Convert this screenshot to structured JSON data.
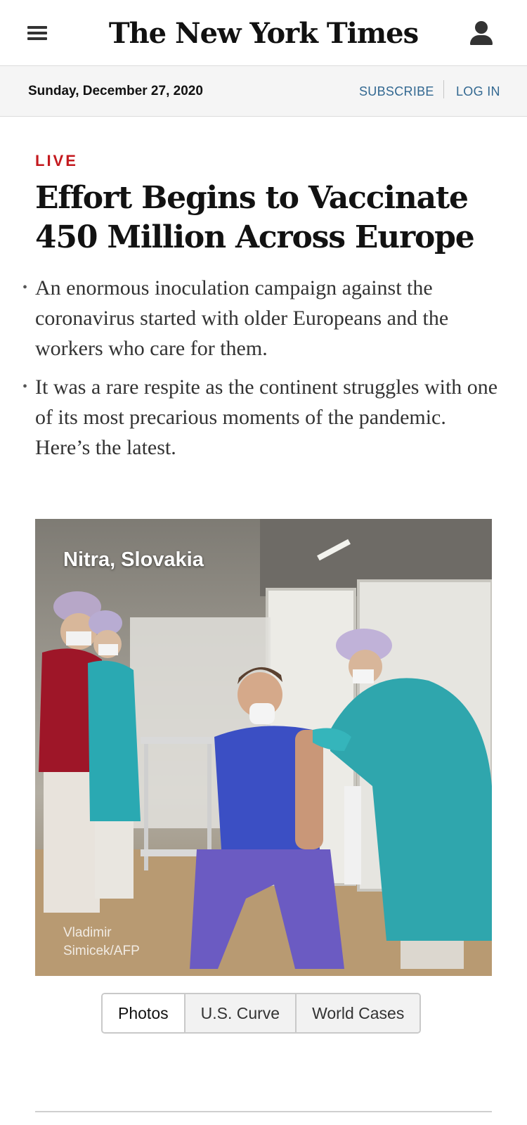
{
  "header": {
    "menu_icon": "hamburger-menu-icon",
    "logo_text": "The New York Times",
    "account_icon": "user-account-icon"
  },
  "datebar": {
    "date": "Sunday, December 27, 2020",
    "subscribe_label": "SUBSCRIBE",
    "login_label": "LOG IN",
    "link_color": "#326891"
  },
  "article": {
    "kicker": "LIVE",
    "kicker_color": "#c4191e",
    "headline": "Effort Begins to Vaccinate 450 Million Across Europe",
    "bullets": [
      "An enormous inoculation campaign against the coronavirus started with older Europeans and the workers who care for them.",
      "It was a rare respite as the continent struggles with one of its most precarious moments of the pandemic. Here’s the latest."
    ]
  },
  "photo": {
    "location": "Nitra, Slovakia",
    "credit": "Vladimir Simicek/AFP"
  },
  "tabs": [
    {
      "label": "Photos",
      "active": true
    },
    {
      "label": "U.S. Curve",
      "active": false
    },
    {
      "label": "World Cases",
      "active": false
    }
  ]
}
